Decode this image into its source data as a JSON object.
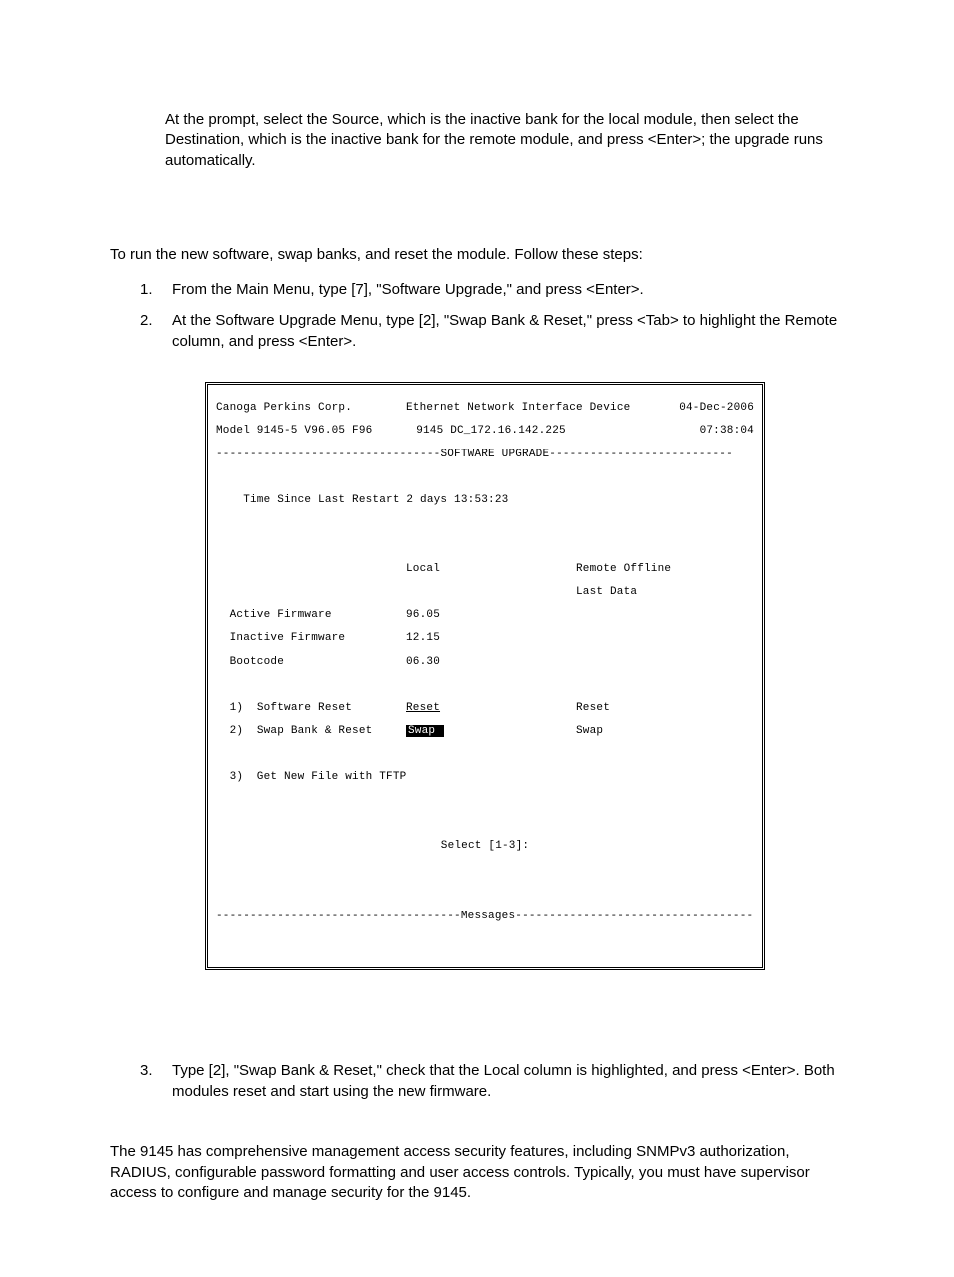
{
  "intro": "At the prompt, select the Source, which is the inactive bank for the local module, then select the Destination, which is the inactive bank for the remote module, and press <Enter>; the upgrade runs automatically.",
  "run_intro": "To run the new software, swap banks, and reset the module.  Follow these steps:",
  "steps_a": [
    {
      "n": "1.",
      "t": "From the Main Menu, type [7], \"Software Upgrade,\" and press <Enter>."
    },
    {
      "n": "2.",
      "t": "At the Software Upgrade Menu, type [2], \"Swap Bank & Reset,\" press <Tab> to highlight the Remote column, and press <Enter>."
    }
  ],
  "term": {
    "corp": "Canoga Perkins Corp.",
    "device": "Ethernet Network Interface Device",
    "date": "04-Dec-2006",
    "model": "Model 9145-5 V96.05 F96",
    "host": "9145 DC_172.16.142.225",
    "time": "07:38:04",
    "bar_upgrade_left": "---------------------------------",
    "bar_upgrade_title": "SOFTWARE UPGRADE",
    "bar_upgrade_right": "---------------------------",
    "since": "    Time Since Last Restart 2 days 13:53:23",
    "col_local": "Local",
    "col_remote": "Remote Offline",
    "col_lastdata": "Last Data",
    "row_active": "  Active Firmware",
    "row_inactive": "  Inactive Firmware",
    "row_boot": "  Bootcode",
    "val_active": "96.05",
    "val_inactive": "12.15",
    "val_boot": "06.30",
    "opt1_n": "  1)",
    "opt1_t": "  Software Reset",
    "opt1_local": "Reset",
    "opt1_remote": "Reset",
    "opt2_n": "  2)",
    "opt2_t": "  Swap Bank & Reset",
    "opt2_local": "Swap ",
    "opt2_remote": "Swap",
    "opt3": "  3)  Get New File with TFTP",
    "select": "Select [1-3]:",
    "bar_msg_left": "------------------------------------",
    "bar_msg_title": "Messages",
    "bar_msg_right": "------------------------------------"
  },
  "steps_b": [
    {
      "n": "3.",
      "t": "Type [2], \"Swap Bank & Reset,\" check that the Local column is highlighted, and press <Enter>.  Both modules reset and start using the new firmware."
    }
  ],
  "security": "The 9145 has comprehensive management access security features, including SNMPv3 authorization, RADIUS, configurable password formatting and user access controls.  Typically, you must have supervisor access to configure and manage security for the 9145."
}
